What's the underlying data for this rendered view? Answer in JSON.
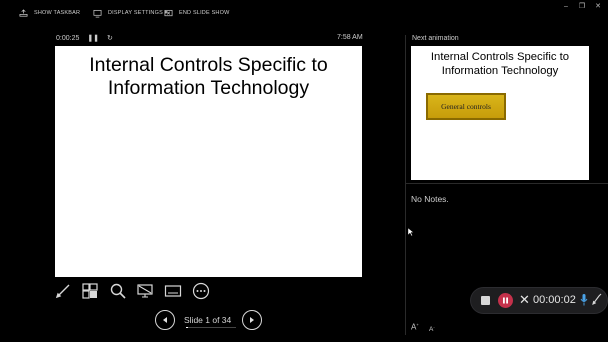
{
  "toolbar": {
    "show_taskbar": "SHOW TASKBAR",
    "display_settings": "DISPLAY SETTINGS ▾",
    "end_slide_show": "END SLIDE SHOW"
  },
  "window": {
    "minimize": "–",
    "restore": "❐",
    "close": "✕"
  },
  "timer": {
    "elapsed": "0:00:25",
    "clock": "7:58 AM"
  },
  "current_slide": {
    "title_line1": "Internal Controls Specific to",
    "title_line2": "Information Technology"
  },
  "tools": [
    "pen-icon",
    "see-all-slides-icon",
    "zoom-icon",
    "screen-icon",
    "subtitles-icon",
    "more-options-icon"
  ],
  "navigation": {
    "slide_counter": "Slide 1 of 34",
    "progress": 0.03
  },
  "next_pane": {
    "label": "Next animation",
    "title_line1": "Internal Controls Specific to",
    "title_line2": "Information Technology",
    "box_text": "General controls"
  },
  "notes": {
    "text": "No Notes."
  },
  "font_buttons": {
    "increase": "A",
    "decrease": "A"
  },
  "recording": {
    "time": "00:00:02",
    "pause_color": "#c4314b"
  }
}
